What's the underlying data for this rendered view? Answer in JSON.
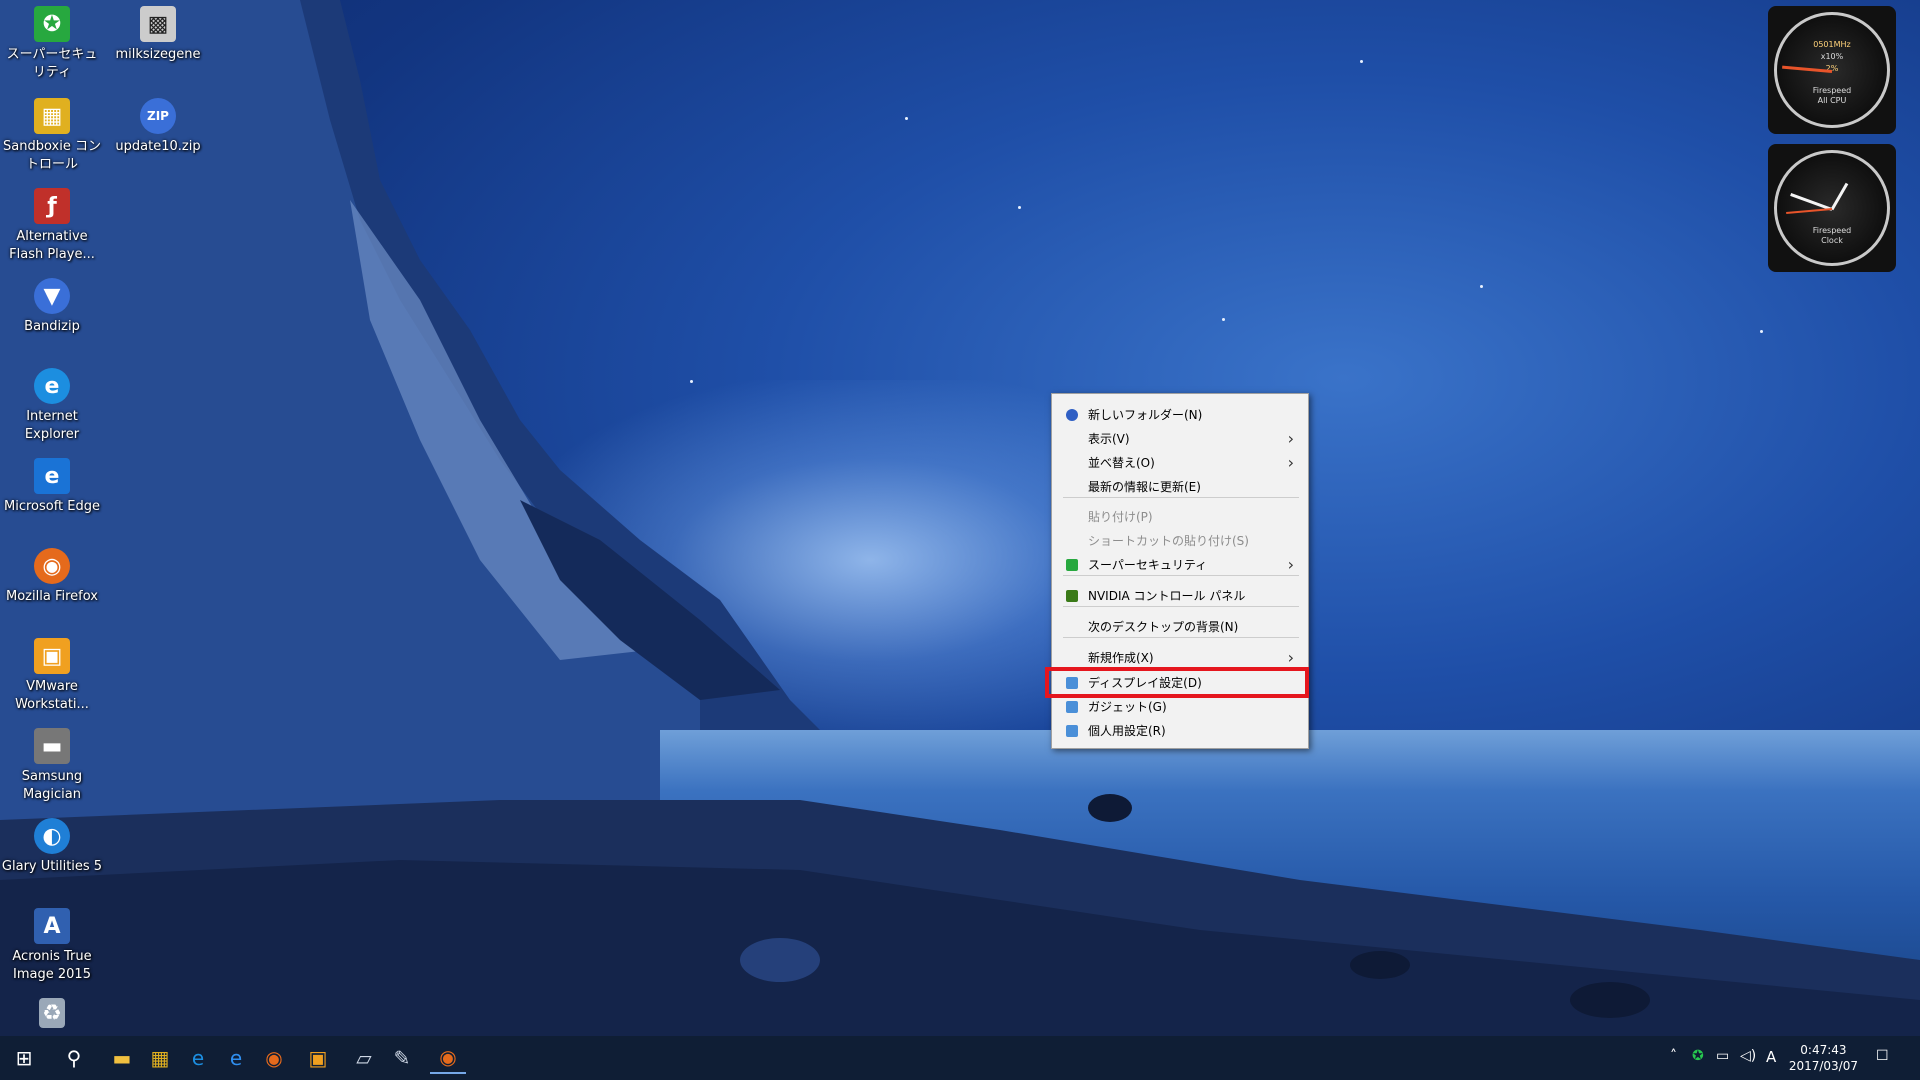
{
  "desktop": {
    "icons": [
      {
        "label": "スーパーセキュ\nリティ",
        "icon": "super-security-icon",
        "color": "#27a83f"
      },
      {
        "label": "Sandboxie コン\nトロール",
        "icon": "sandboxie-icon",
        "color": "#e0b020"
      },
      {
        "label": "Alternative\nFlash Playe...",
        "icon": "flash-player-icon",
        "color": "#c0302a"
      },
      {
        "label": "Bandizip",
        "icon": "bandizip-icon",
        "color": "#3a6fd8"
      },
      {
        "label": "Internet\nExplorer",
        "icon": "internet-explorer-icon",
        "color": "#1c8ee0"
      },
      {
        "label": "Microsoft Edge",
        "icon": "edge-icon",
        "color": "#1a73d6"
      },
      {
        "label": "Mozilla Firefox",
        "icon": "firefox-icon",
        "color": "#e56a1c"
      },
      {
        "label": "VMware\nWorkstati...",
        "icon": "vmware-icon",
        "color": "#f0a020"
      },
      {
        "label": "Samsung\nMagician",
        "icon": "samsung-magician-icon",
        "color": "#777777"
      },
      {
        "label": "Glary Utilities 5",
        "icon": "glary-utilities-icon",
        "color": "#1f7fd6"
      },
      {
        "label": "Acronis True\nImage 2015",
        "icon": "acronis-icon",
        "color": "#3060b0"
      },
      {
        "label": "",
        "icon": "recycle-bin-icon",
        "color": "#9aa8b8"
      }
    ],
    "icons_col2": [
      {
        "label": "milksizegene",
        "icon": "milksizegene-icon",
        "color": "#cccccc"
      },
      {
        "label": "update10.zip",
        "icon": "zip-file-icon",
        "color": "#3a6fd8"
      }
    ]
  },
  "gadgets": {
    "cpu": {
      "line1": "0501MHz",
      "line2": "x10%",
      "value": "2%",
      "line3": "Firespeed",
      "line4": "All CPU"
    },
    "clock": {
      "line1": "Firespeed",
      "line2": "Clock"
    }
  },
  "context_menu": {
    "items": [
      {
        "label": "新しいフォルダー(N)",
        "icon": "new-folder-icon"
      },
      {
        "label": "表示(V)",
        "submenu": true
      },
      {
        "label": "並べ替え(O)",
        "submenu": true
      },
      {
        "label": "最新の情報に更新(E)"
      },
      {
        "label": "貼り付け(P)",
        "disabled": true
      },
      {
        "label": "ショートカットの貼り付け(S)",
        "disabled": true
      },
      {
        "label": "スーパーセキュリティ",
        "icon": "super-security-icon",
        "submenu": true
      },
      {
        "label": "NVIDIA コントロール パネル",
        "icon": "nvidia-icon"
      },
      {
        "label": "次のデスクトップの背景(N)"
      },
      {
        "label": "新規作成(X)",
        "submenu": true
      },
      {
        "label": "ディスプレイ設定(D)",
        "icon": "display-settings-icon",
        "highlighted": true
      },
      {
        "label": "ガジェット(G)",
        "icon": "gadgets-icon"
      },
      {
        "label": "個人用設定(R)",
        "icon": "personalize-icon"
      }
    ],
    "highlight_color": "#e5161e"
  },
  "taskbar": {
    "apps": [
      "windows-start-icon",
      "search-icon",
      "file-explorer-icon",
      "sandboxie-icon",
      "internet-explorer-icon",
      "edge-icon",
      "firefox-icon",
      "vmware-icon",
      "notepad-icon",
      "tools-icon",
      "firefox-active-icon"
    ],
    "ime": "A",
    "time": "0:47:43",
    "date": "2017/03/07"
  }
}
